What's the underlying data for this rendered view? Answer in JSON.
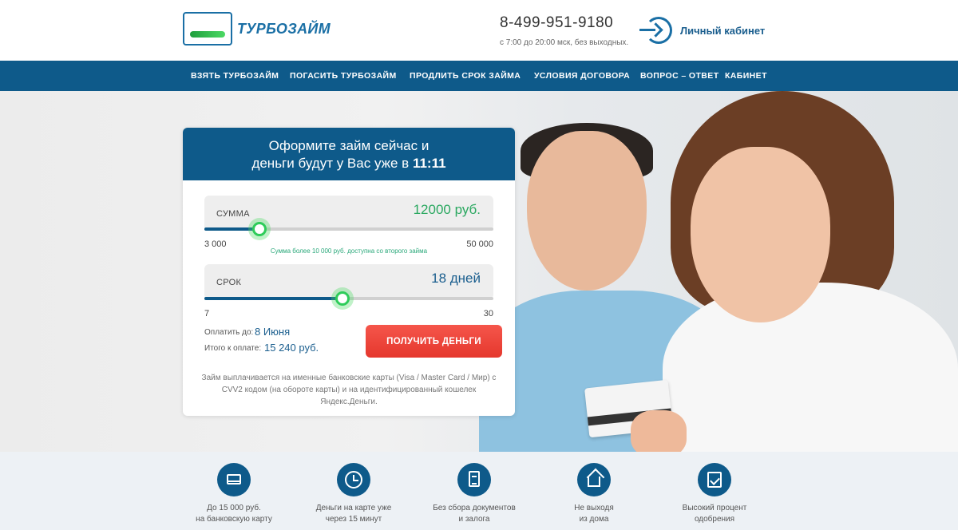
{
  "header": {
    "logo_text": "ТУРБОЗАЙМ",
    "phone": "8-499-951-9180",
    "hours": "с 7:00 до 20:00 мск, без выходных.",
    "cabinet_label": "Личный кабинет"
  },
  "nav": {
    "items": [
      {
        "label": "ВЗЯТЬ ТУРБОЗАЙМ"
      },
      {
        "label": "ПОГАСИТЬ ТУРБОЗАЙМ"
      },
      {
        "label": "ПРОДЛИТЬ СРОК ЗАЙМА"
      },
      {
        "label": "УСЛОВИЯ ДОГОВОРА"
      },
      {
        "label": "ВОПРОС – ОТВЕТ"
      },
      {
        "label": "КАБИНЕТ"
      }
    ]
  },
  "form": {
    "title_line1": "Оформите займ сейчас и",
    "title_line2": "деньги будут у Вас уже в",
    "title_time": "11:11",
    "amount": {
      "label": "СУММА",
      "value": "12000 руб.",
      "min": "3 000",
      "max": "50 000",
      "position": 0.191,
      "note": "Сумма более 10 000 руб. доступна со второго займа"
    },
    "term": {
      "label": "СРОК",
      "value": "18 дней",
      "min": "7",
      "max": "30",
      "position": 0.478
    },
    "pay_until_label": "Оплатить до:",
    "pay_until_value": "8 Июня",
    "total_label": "Итого к оплате:",
    "total_value": "15 240 руб.",
    "cta_label": "ПОЛУЧИТЬ ДЕНЬГИ",
    "disclaimer": "Займ выплачивается на именные банковские карты (Visa / Master Card / Мир) с CVV2 кодом (на обороте карты) и на идентифицированный кошелек Яндекс.Деньги."
  },
  "features": [
    {
      "line1": "До 15 000 руб.",
      "line2": "на банковскую карту",
      "icon": "card-icon"
    },
    {
      "line1": "Деньги на карте уже",
      "line2": "через 15 минут",
      "icon": "clock-icon"
    },
    {
      "line1": "Без сбора документов",
      "line2": "и залога",
      "icon": "document-icon"
    },
    {
      "line1": "Не выходя",
      "line2": "из дома",
      "icon": "house-icon"
    },
    {
      "line1": "Высокий процент",
      "line2": "одобрения",
      "icon": "checklist-icon"
    }
  ],
  "colors": {
    "brand_blue": "#0e5a8a",
    "accent_green": "#2ecc5a",
    "cta_red": "#e5372d"
  }
}
